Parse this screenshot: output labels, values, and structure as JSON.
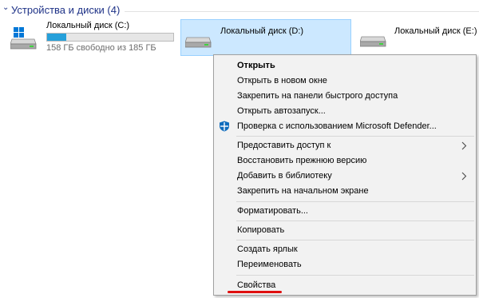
{
  "group": {
    "title": "Устройства и диски (4)"
  },
  "drives": [
    {
      "name": "Локальный диск (C:)",
      "space_text": "158 ГБ свободно из 185 ГБ",
      "used_fraction": 0.15,
      "has_windows_logo": true,
      "selected": false
    },
    {
      "name": "Локальный диск (D:)",
      "selected": true
    },
    {
      "name": "Локальный диск (E:)",
      "selected": false
    }
  ],
  "menu": {
    "items": [
      {
        "label": "Открыть",
        "bold": true
      },
      {
        "label": "Открыть в новом окне"
      },
      {
        "label": "Закрепить на панели быстрого доступа"
      },
      {
        "label": "Открыть автозапуск..."
      },
      {
        "label": "Проверка с использованием Microsoft Defender...",
        "icon": "defender-shield-icon"
      },
      {
        "label": "Предоставить доступ к",
        "submenu": true
      },
      {
        "label": "Восстановить прежнюю версию"
      },
      {
        "label": "Добавить в библиотеку",
        "submenu": true
      },
      {
        "label": "Закрепить на начальном экране"
      },
      {
        "label": "Форматировать..."
      },
      {
        "label": "Копировать"
      },
      {
        "label": "Создать ярлык"
      },
      {
        "label": "Переименовать"
      },
      {
        "label": "Свойства"
      }
    ]
  },
  "colors": {
    "accent_header": "#1e3287",
    "selection_bg": "#cce8ff",
    "selection_border": "#99d1ff",
    "usage_bar_fill": "#26a0da",
    "menu_bg": "#f2f2f2",
    "highlight_underline": "#e01010",
    "defender_blue": "#0f6cbd"
  }
}
